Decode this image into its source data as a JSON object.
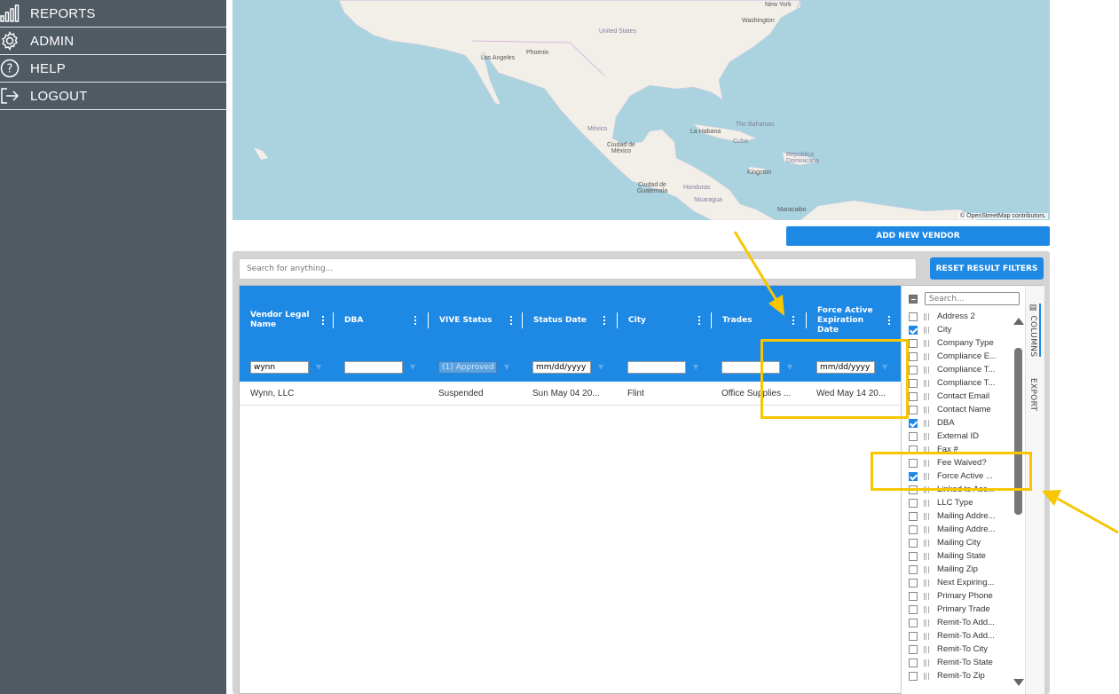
{
  "sidebar": {
    "items": [
      {
        "label": "REPORTS",
        "icon": "bar-chart-icon"
      },
      {
        "label": "ADMIN",
        "icon": "gear-icon"
      },
      {
        "label": "HELP",
        "icon": "help-icon"
      },
      {
        "label": "LOGOUT",
        "icon": "logout-icon"
      }
    ]
  },
  "map": {
    "labels": [
      "New York",
      "Washington",
      "United States",
      "Los Angeles",
      "Phoenix",
      "México",
      "Ciudad de México",
      "La Habana",
      "The Bahamas",
      "Cuba",
      "República Dominicana",
      "Kingston",
      "Ciudad de Guatemala",
      "Honduras",
      "Nicaragua",
      "Maracaibo"
    ],
    "attribution": "© OpenStreetMap contributors."
  },
  "toolbar": {
    "add_vendor_label": "ADD NEW VENDOR",
    "search_placeholder": "Search for anything...",
    "reset_label": "RESET RESULT FILTERS"
  },
  "grid": {
    "columns": [
      "Vendor Legal Name",
      "DBA",
      "VIVE Status",
      "Status Date",
      "City",
      "Trades",
      "Force Active Expiration Date"
    ],
    "filters": {
      "vendor": "wynn",
      "vive_status": "(1) Approved",
      "status_date": "mm/dd/yyyy",
      "force_active": "mm/dd/yyyy"
    },
    "rows": [
      {
        "vendor": "Wynn, LLC",
        "dba": "",
        "vive_status": "Suspended",
        "status_date": "Sun May 04 20...",
        "city": "Flint",
        "trades": "Office Supplies ...",
        "force_active": "Wed May 14 20..."
      }
    ]
  },
  "columns_panel": {
    "search_placeholder": "Search...",
    "items": [
      {
        "label": "Address 2",
        "checked": false
      },
      {
        "label": "City",
        "checked": true
      },
      {
        "label": "Company Type",
        "checked": false
      },
      {
        "label": "Compliance E...",
        "checked": false
      },
      {
        "label": "Compliance T...",
        "checked": false
      },
      {
        "label": "Compliance T...",
        "checked": false
      },
      {
        "label": "Contact Email",
        "checked": false
      },
      {
        "label": "Contact Name",
        "checked": false
      },
      {
        "label": "DBA",
        "checked": true
      },
      {
        "label": "External ID",
        "checked": false
      },
      {
        "label": "Fax #",
        "checked": false
      },
      {
        "label": "Fee Waived?",
        "checked": false
      },
      {
        "label": "Force Active ...",
        "checked": true
      },
      {
        "label": "Linked to Acc...",
        "checked": false
      },
      {
        "label": "LLC Type",
        "checked": false
      },
      {
        "label": "Mailing Addre...",
        "checked": false
      },
      {
        "label": "Mailing Addre...",
        "checked": false
      },
      {
        "label": "Mailing City",
        "checked": false
      },
      {
        "label": "Mailing State",
        "checked": false
      },
      {
        "label": "Mailing Zip",
        "checked": false
      },
      {
        "label": "Next Expiring...",
        "checked": false
      },
      {
        "label": "Primary Phone",
        "checked": false
      },
      {
        "label": "Primary Trade",
        "checked": false
      },
      {
        "label": "Remit-To Add...",
        "checked": false
      },
      {
        "label": "Remit-To Add...",
        "checked": false
      },
      {
        "label": "Remit-To City",
        "checked": false
      },
      {
        "label": "Remit-To State",
        "checked": false
      },
      {
        "label": "Remit-To Zip",
        "checked": false
      }
    ],
    "tabs": [
      "COLUMNS",
      "EXPORT"
    ]
  },
  "colors": {
    "accent": "#1e88e5",
    "sidebar": "#4f5a63",
    "highlight": "#f7c600"
  }
}
